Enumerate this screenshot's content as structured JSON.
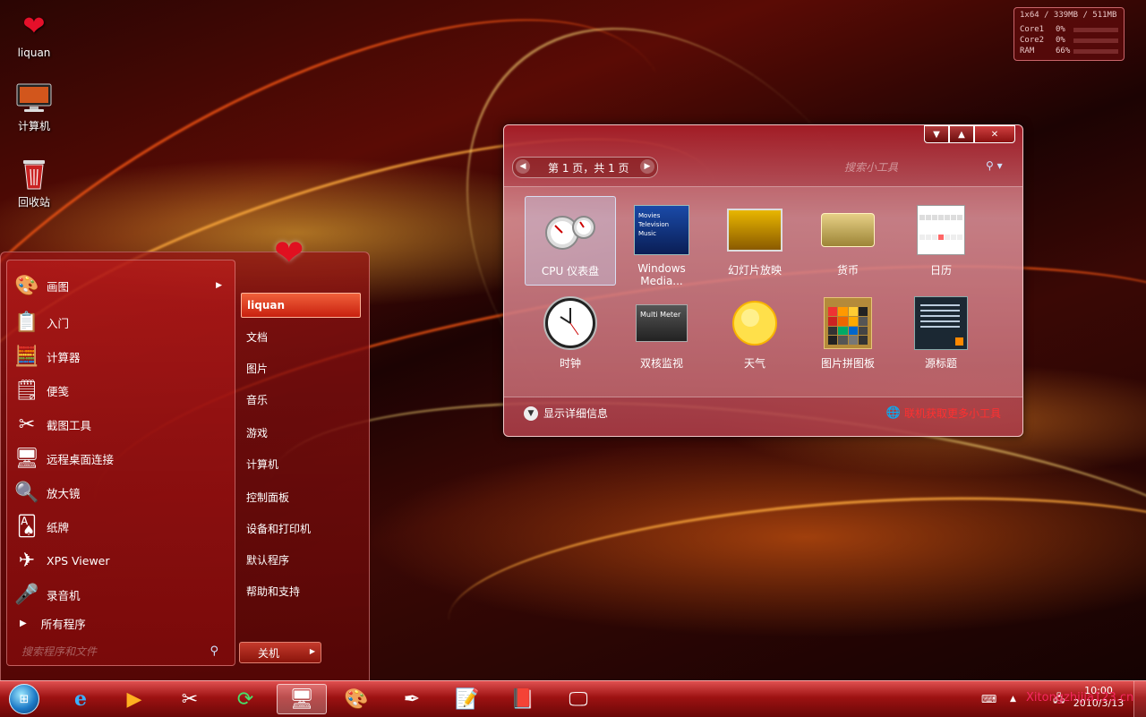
{
  "desktop": {
    "icons": [
      {
        "label": "liquan",
        "icon": "hearts-user-icon"
      },
      {
        "label": "计算机",
        "icon": "computer-icon"
      },
      {
        "label": "回收站",
        "icon": "recycle-bin-icon"
      }
    ]
  },
  "sysmon": {
    "header": "1x64 / 339MB / 511MB",
    "rows": [
      {
        "name": "Core1",
        "value": "0%",
        "level": 0
      },
      {
        "name": "Core2",
        "value": "0%",
        "level": 0
      },
      {
        "name": "RAM",
        "value": "66%",
        "level": 0.66
      }
    ],
    "bar_color": "#3fc15a"
  },
  "start_menu": {
    "programs": [
      {
        "label": "画图",
        "icon": "paint-icon",
        "has_submenu": true
      },
      {
        "label": "入门",
        "icon": "getting-started-icon",
        "has_submenu": false
      },
      {
        "label": "计算器",
        "icon": "calculator-icon",
        "has_submenu": false
      },
      {
        "label": "便笺",
        "icon": "sticky-notes-icon",
        "has_submenu": false
      },
      {
        "label": "截图工具",
        "icon": "snipping-tool-icon",
        "has_submenu": false
      },
      {
        "label": "远程桌面连接",
        "icon": "remote-desktop-icon",
        "has_submenu": false
      },
      {
        "label": "放大镜",
        "icon": "magnifier-icon",
        "has_submenu": false
      },
      {
        "label": "纸牌",
        "icon": "solitaire-icon",
        "has_submenu": false
      },
      {
        "label": "XPS Viewer",
        "icon": "xps-viewer-icon",
        "has_submenu": false
      },
      {
        "label": "录音机",
        "icon": "sound-recorder-icon",
        "has_submenu": false
      }
    ],
    "all_programs": "所有程序",
    "search_placeholder": "搜索程序和文件",
    "right_items": [
      "liquan",
      "文档",
      "图片",
      "音乐",
      "游戏",
      "计算机",
      "控制面板",
      "设备和打印机",
      "默认程序",
      "帮助和支持"
    ],
    "shutdown_label": "关机"
  },
  "gallery": {
    "page_label": "第 1 页，共 1 页",
    "search_placeholder": "搜索小工具",
    "gadgets": [
      {
        "label": "CPU 仪表盘",
        "icon": "cpu-meter-icon",
        "selected": true
      },
      {
        "label": "Windows Media...",
        "icon": "media-center-icon",
        "selected": false
      },
      {
        "label": "幻灯片放映",
        "icon": "slideshow-icon",
        "selected": false
      },
      {
        "label": "货币",
        "icon": "currency-icon",
        "selected": false
      },
      {
        "label": "日历",
        "icon": "calendar-icon",
        "selected": false
      },
      {
        "label": "时钟",
        "icon": "clock-icon",
        "selected": false
      },
      {
        "label": "双核监视",
        "icon": "multi-meter-icon",
        "selected": false
      },
      {
        "label": "天气",
        "icon": "weather-icon",
        "selected": false
      },
      {
        "label": "图片拼图板",
        "icon": "puzzle-icon",
        "selected": false
      },
      {
        "label": "源标题",
        "icon": "feed-headlines-icon",
        "selected": false
      }
    ],
    "media_tile_text": "Movies\nTelevision\nMusic",
    "multimeter_text": "Multi Meter",
    "details_label": "显示详细信息",
    "get_more_label": "联机获取更多小工具"
  },
  "taskbar": {
    "apps": [
      {
        "icon": "internet-explorer-icon",
        "active": false
      },
      {
        "icon": "media-player-icon",
        "active": false
      },
      {
        "icon": "snipping-tool-icon",
        "active": false
      },
      {
        "icon": "refresh-green-icon",
        "active": false
      },
      {
        "icon": "remote-desktop-icon",
        "active": true
      },
      {
        "icon": "paint-icon",
        "active": false
      },
      {
        "icon": "feather-app-icon",
        "active": false
      },
      {
        "icon": "wordpad-icon",
        "active": false
      },
      {
        "icon": "book-icon",
        "active": false
      },
      {
        "icon": "monitor-icon",
        "active": false
      }
    ],
    "time": "10:00",
    "date": "2010/3/13"
  },
  "watermark": "Xitongzhijia123.cn"
}
